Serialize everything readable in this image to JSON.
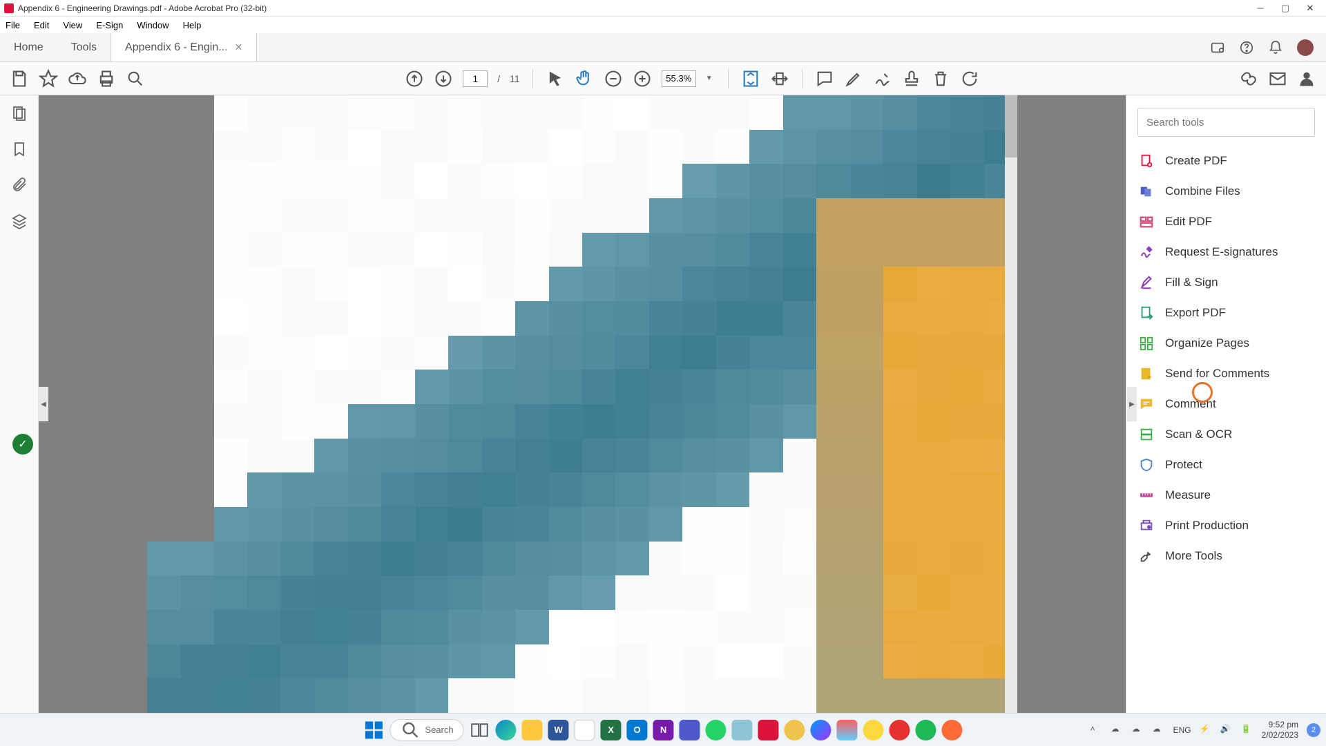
{
  "window": {
    "title": "Appendix 6 - Engineering Drawings.pdf - Adobe Acrobat Pro (32-bit)"
  },
  "menu": {
    "file": "File",
    "edit": "Edit",
    "view": "View",
    "esign": "E-Sign",
    "window": "Window",
    "help": "Help"
  },
  "tabs": {
    "home": "Home",
    "tools": "Tools",
    "document": "Appendix 6 - Engin..."
  },
  "page": {
    "current": "1",
    "separator": "/",
    "total": "11"
  },
  "zoom": {
    "value": "55.3%"
  },
  "rightPanel": {
    "searchPlaceholder": "Search tools",
    "items": {
      "create": "Create PDF",
      "combine": "Combine Files",
      "edit": "Edit PDF",
      "esign": "Request E-signatures",
      "fillsign": "Fill & Sign",
      "export": "Export PDF",
      "organize": "Organize Pages",
      "sendcomments": "Send for Comments",
      "comment": "Comment",
      "scanocr": "Scan & OCR",
      "protect": "Protect",
      "measure": "Measure",
      "printprod": "Print Production",
      "more": "More Tools"
    }
  },
  "taskbar": {
    "search": "Search",
    "lang": "ENG",
    "time": "9:52 pm",
    "date": "2/02/2023",
    "notif": "2"
  }
}
